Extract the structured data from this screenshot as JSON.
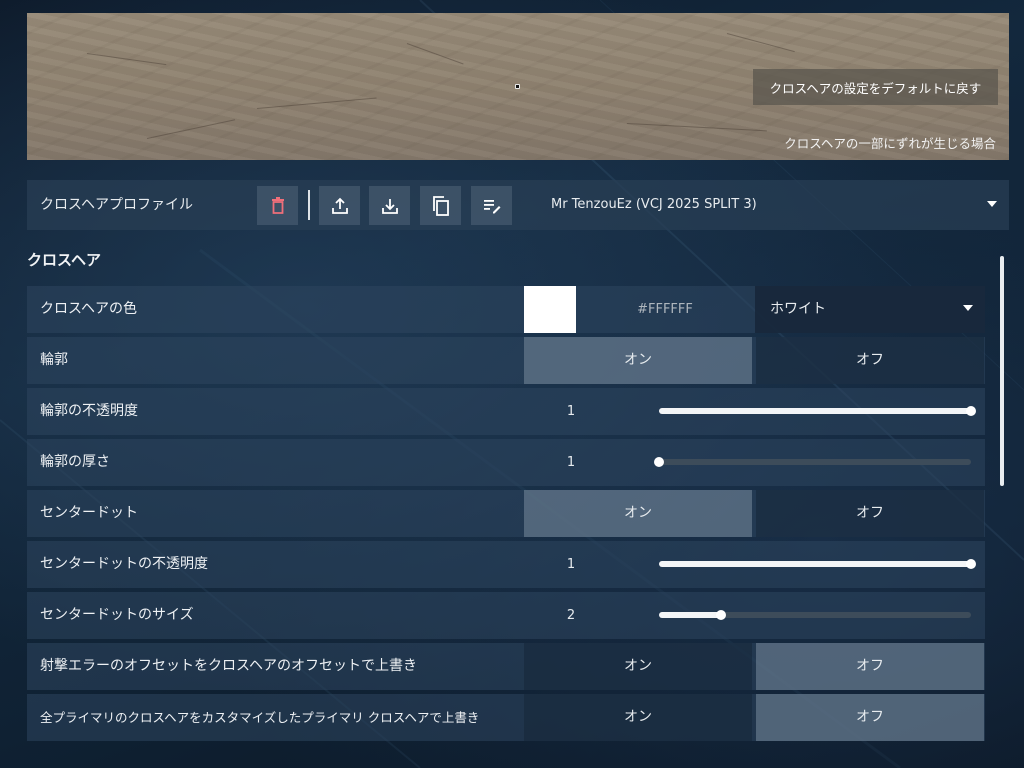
{
  "preview": {
    "reset_button": "クロスヘアの設定をデフォルトに戻す",
    "misalign_link": "クロスヘアの一部にずれが生じる場合"
  },
  "profile_bar": {
    "label": "クロスヘアプロファイル",
    "selected_profile": "Mr TenzouEz (VCJ 2025 SPLIT 3)",
    "tools": [
      "trash-icon",
      "upload-icon",
      "download-icon",
      "copy-icon",
      "rename-icon"
    ]
  },
  "section": {
    "title": "クロスヘア"
  },
  "settings": {
    "color": {
      "label": "クロスヘアの色",
      "hex": "#FFFFFF",
      "selected": "ホワイト",
      "swatch": "#ffffff"
    },
    "outline": {
      "label": "輪郭",
      "on": "オン",
      "off": "オフ",
      "active": "on"
    },
    "outline_opacity": {
      "label": "輪郭の不透明度",
      "value": "1",
      "fraction": 1.0
    },
    "outline_thickness": {
      "label": "輪郭の厚さ",
      "value": "1",
      "fraction": 0.0
    },
    "center_dot": {
      "label": "センタードット",
      "on": "オン",
      "off": "オフ",
      "active": "on"
    },
    "center_dot_opacity": {
      "label": "センタードットの不透明度",
      "value": "1",
      "fraction": 1.0
    },
    "center_dot_size": {
      "label": "センタードットのサイズ",
      "value": "2",
      "fraction": 0.2
    },
    "firing_error_override": {
      "label": "射撃エラーのオフセットをクロスヘアのオフセットで上書き",
      "on": "オン",
      "off": "オフ",
      "active": "off"
    },
    "primary_override": {
      "label": "全プライマリのクロスヘアをカスタマイズしたプライマリ クロスヘアで上書き",
      "on": "オン",
      "off": "オフ",
      "active": "off"
    }
  },
  "colors": {
    "accent_delete": "#ef6f7a",
    "text": "#e8ecef"
  }
}
